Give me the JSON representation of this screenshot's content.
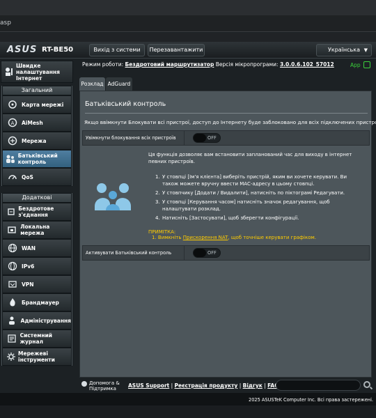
{
  "browser": {
    "address_fragment": "asp"
  },
  "header": {
    "logo": "ASUS",
    "model": "RT-BE50",
    "logout_label": "Вихід з системи",
    "reboot_label": "Перезавантажити",
    "language": "Українська"
  },
  "sidebar": {
    "quick_setup": "Швидке налаштування Інтернет",
    "general_header": "Загальний",
    "general_items": [
      {
        "label": "Карта мережі",
        "icon": "network-map-icon"
      },
      {
        "label": "AiMesh",
        "icon": "aimesh-icon"
      },
      {
        "label": "Мережа",
        "icon": "network-icon"
      },
      {
        "label": "Батьківський контроль",
        "icon": "parental-control-icon"
      },
      {
        "label": "QoS",
        "icon": "qos-icon"
      }
    ],
    "advanced_header": "Додаткові налаштування",
    "advanced_items": [
      {
        "label": "Бездротове з'єднання",
        "icon": "wireless-icon"
      },
      {
        "label": "Локальна мережа",
        "icon": "lan-icon"
      },
      {
        "label": "WAN",
        "icon": "wan-icon"
      },
      {
        "label": "IPv6",
        "icon": "ipv6-icon"
      },
      {
        "label": "VPN",
        "icon": "vpn-icon"
      },
      {
        "label": "Брандмауер",
        "icon": "firewall-icon"
      },
      {
        "label": "Адміністрування",
        "icon": "administration-icon"
      },
      {
        "label": "Системний журнал",
        "icon": "system-log-icon"
      },
      {
        "label": "Мережеві інструменти",
        "icon": "network-tools-icon"
      }
    ]
  },
  "status": {
    "mode_label": "Режим роботи:",
    "mode_value": "Бездротовий маршрутизатор",
    "firmware_label": "Версія мікропрограми:",
    "firmware_value": "3.0.0.6.102_57012",
    "app_label": "App"
  },
  "tabs": [
    {
      "label": "Розклад",
      "active": true
    },
    {
      "label": "AdGuard",
      "active": false
    }
  ],
  "panel": {
    "title": "Батьківський контроль",
    "notice": "Якщо ввімкнути Блокувати всі пристрої, доступ до Інтернету буде заблоковано для всіх підключених пристроїв.",
    "block_all_label": "Увімкнути блокування всіх пристроїв",
    "block_all_state": "OFF",
    "intro": "Ця функція дозволяє вам встановити запланований час для виходу в інтернет певних пристроїв.",
    "steps": [
      "У стовпці [Ім'я клієнта] виберіть пристрій, яким ви хочете керувати. Ви також можете вручну ввести MAC-адресу в цьому стовпці.",
      "У стовпчику [Додати / Видалити], натисніть по піктограмі Редагувати.",
      "У стовпці [Керування часом] натисніть значок редагування, щоб налаштувати розклад.",
      "Натисніть [Застосувати], щоб зберегти конфігурації."
    ],
    "note_title": "ПРИМІТКА:",
    "note_prefix": "1. Вимкніть ",
    "note_link": "Прискорення NAT",
    "note_suffix": ", щоб точніше керувати графіком.",
    "enable_label": "Активувати Батьківський контроль",
    "enable_state": "OFF"
  },
  "footer": {
    "help_line1": "Допомога &",
    "help_line2": "Підтримка",
    "links": [
      "ASUS Support",
      "Реєстрація продукту",
      "Відгук",
      "FAQ"
    ],
    "copyright": "2025 ASUSTeK Computer Inc. Всі права застережені."
  },
  "colors": {
    "active_nav": "#4f7ea0",
    "panel_bg": "#4d565b",
    "note_yellow": "#ffcc00",
    "app_green": "#3bd23b"
  }
}
